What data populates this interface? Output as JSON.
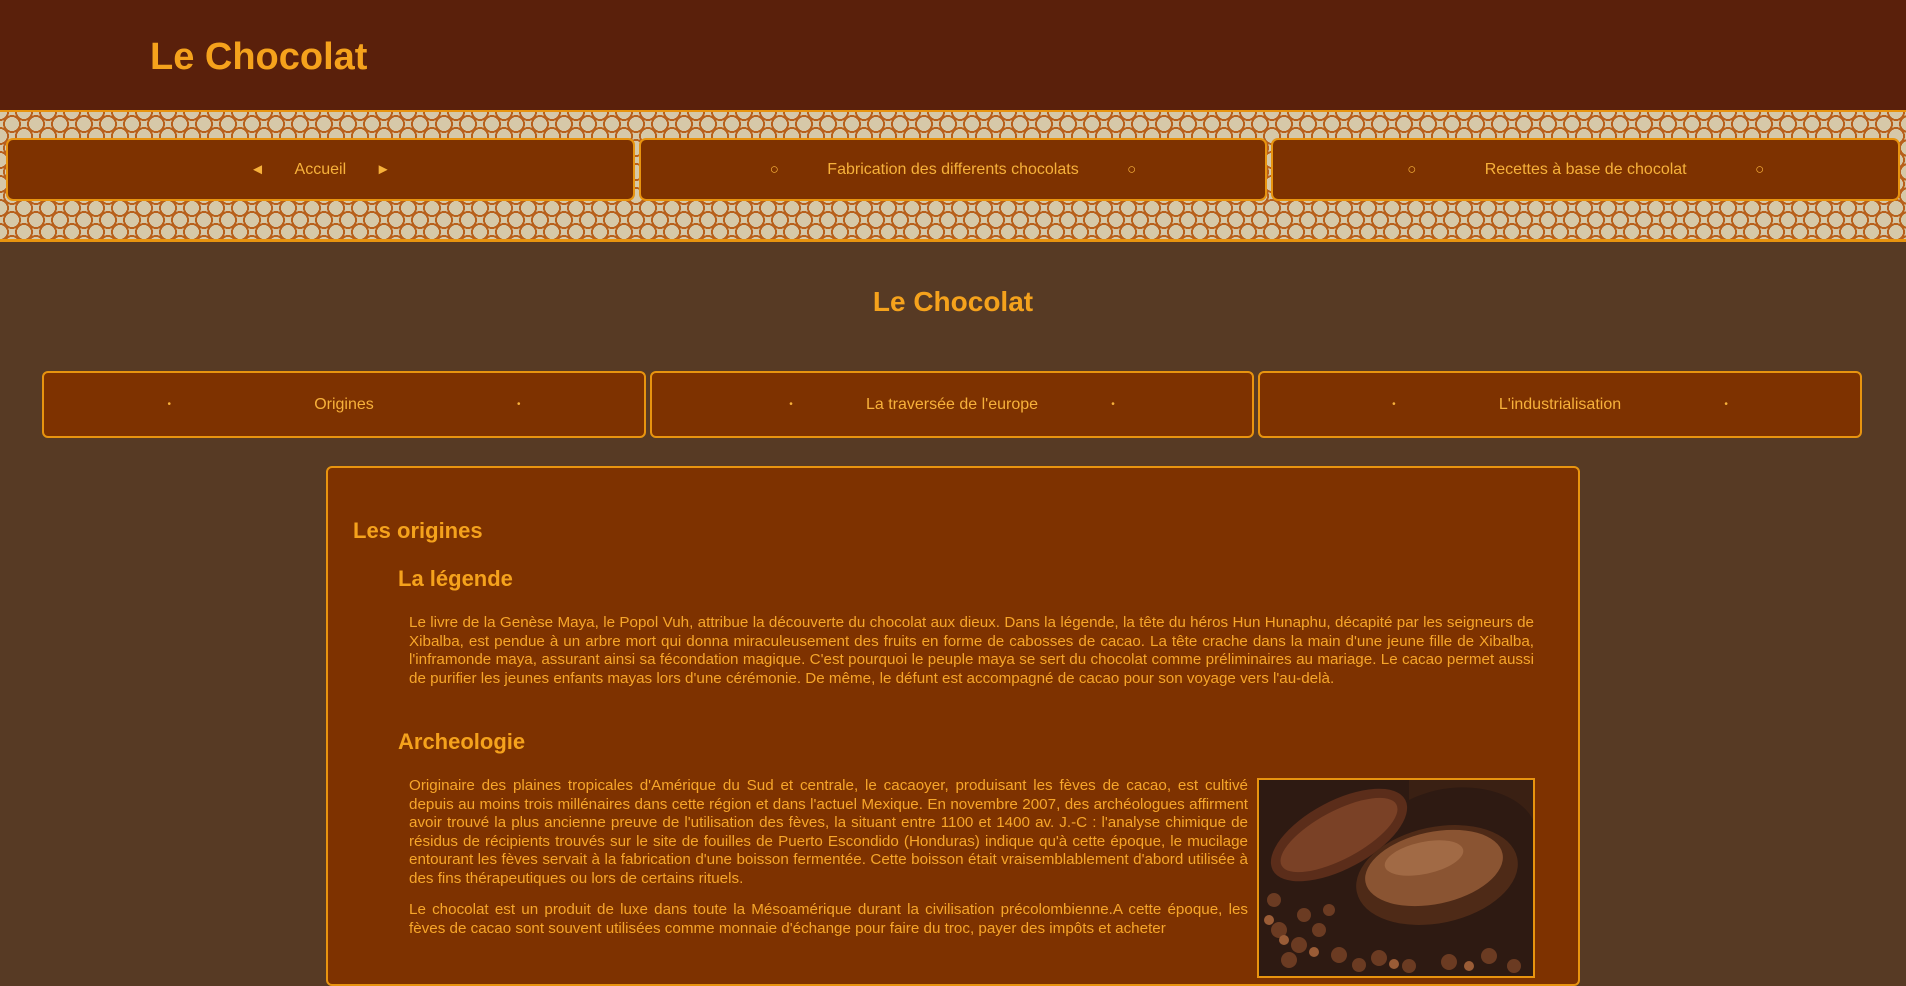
{
  "site": {
    "title": "Le Chocolat"
  },
  "topnav": [
    {
      "label": "Accueil",
      "marker_left": "◄",
      "marker_right": "►"
    },
    {
      "label": "Fabrication des differents chocolats",
      "marker_left": "○",
      "marker_right": "○"
    },
    {
      "label": "Recettes à base de chocolat",
      "marker_left": "○",
      "marker_right": "○"
    }
  ],
  "page": {
    "heading": "Le Chocolat"
  },
  "subnav": [
    {
      "label": "Origines",
      "marker": "•"
    },
    {
      "label": "La traversée de l'europe",
      "marker": "•"
    },
    {
      "label": "L'industrialisation",
      "marker": "•"
    }
  ],
  "article": {
    "section_title": "Les origines",
    "legend": {
      "title": "La légende",
      "text": "Le livre de la Genèse Maya, le Popol Vuh, attribue la découverte du chocolat aux dieux. Dans la légende, la tête du héros Hun Hunaphu, décapité par les seigneurs de Xibalba, est pendue à un arbre mort qui donna miraculeusement des fruits en forme de cabosses de cacao. La tête crache dans la main d'une jeune fille de Xibalba, l'inframonde maya, assurant ainsi sa fécondation magique. C'est pourquoi le peuple maya se sert du chocolat comme préliminaires au mariage. Le cacao permet aussi de purifier les jeunes enfants mayas lors d'une cérémonie. De même, le défunt est accompagné de cacao pour son voyage vers l'au-delà."
    },
    "archeology": {
      "title": "Archeologie",
      "text1": "Originaire des plaines tropicales d'Amérique du Sud et centrale, le cacaoyer, produisant les fèves de cacao, est cultivé depuis au moins trois millénaires dans cette région et dans l'actuel Mexique. En novembre 2007, des archéologues affirment avoir trouvé la plus ancienne preuve de l'utilisation des fèves, la situant entre 1100 et 1400 av. J.-C : l'analyse chimique de résidus de récipients trouvés sur le site de fouilles de Puerto Escondido (Honduras) indique qu'à cette époque, le mucilage entourant les fèves servait à la fabrication d'une boisson fermentée. Cette boisson était vraisemblablement d'abord utilisée à des fins thérapeutiques ou lors de certains rituels.",
      "text2": "Le chocolat est un produit de luxe dans toute la Mésoamérique durant la civilisation précolombienne.A cette époque, les fèves de cacao sont souvent utilisées comme monnaie d'échange pour faire du troc, payer des impôts et acheter"
    }
  },
  "colors": {
    "header_bg": "#5a200b",
    "page_bg": "#573a24",
    "panel_bg": "#7e3200",
    "accent": "#f5a21c",
    "border": "#e8940f"
  }
}
